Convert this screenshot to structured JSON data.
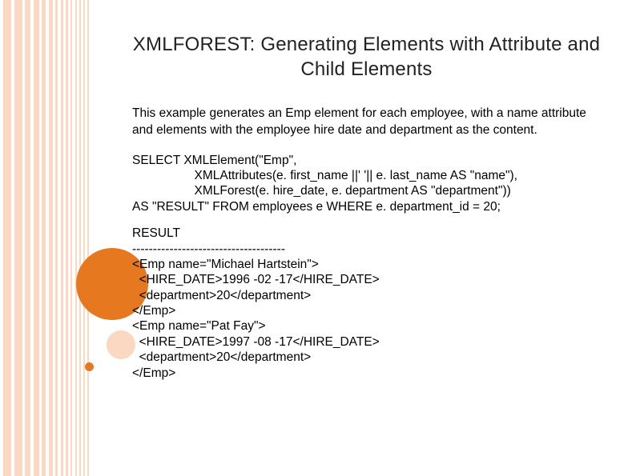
{
  "title": "XMLFOREST: Generating Elements with Attribute and Child Elements",
  "description": "This example generates an Emp element for each employee, with a name attribute and elements with the employee hire date and department as the content.",
  "sql": "SELECT XMLElement(\"Emp\",\n                  XMLAttributes(e. first_name ||' '|| e. last_name AS \"name\"),\n                  XMLForest(e. hire_date, e. department AS \"department\"))\nAS \"RESULT\" FROM employees e WHERE e. department_id = 20;",
  "result": "RESULT\n-------------------------------------\n<Emp name=\"Michael Hartstein\">\n  <HIRE_DATE>1996 -02 -17</HIRE_DATE>\n  <department>20</department>\n</Emp>\n<Emp name=\"Pat Fay\">\n  <HIRE_DATE>1997 -08 -17</HIRE_DATE>\n  <department>20</department>\n</Emp>"
}
